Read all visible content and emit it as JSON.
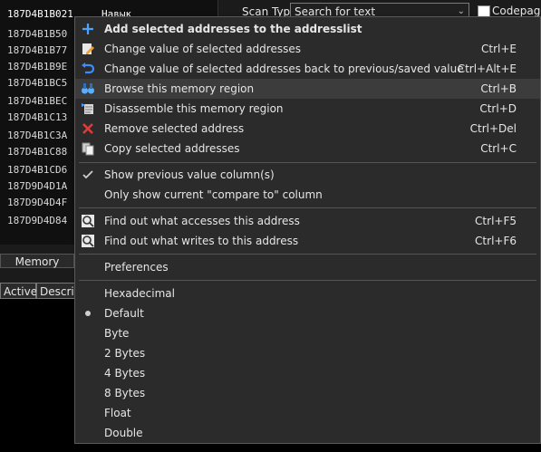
{
  "address_list": {
    "rows": [
      {
        "address": "187D4B1B021",
        "value": "Навык",
        "selected": true
      },
      {
        "address": "187D4B1B50",
        "value": ""
      },
      {
        "address": "187D4B1B77",
        "value": ""
      },
      {
        "address": "187D4B1B9E",
        "value": ""
      },
      {
        "address": "187D4B1BC5",
        "value": ""
      },
      {
        "address": "187D4B1BEC",
        "value": ""
      },
      {
        "address": "187D4B1C13",
        "value": ""
      },
      {
        "address": "187D4B1C3A",
        "value": ""
      },
      {
        "address": "187D4B1C88",
        "value": ""
      },
      {
        "address": "187D4B1CD6",
        "value": ""
      },
      {
        "address": "187D9D4D1A",
        "value": ""
      },
      {
        "address": "187D9D4D4F",
        "value": ""
      },
      {
        "address": "187D9D4D84",
        "value": ""
      }
    ]
  },
  "scan": {
    "type_label": "Scan Type",
    "type_value": "Search for text",
    "codepage_label": "Codepage"
  },
  "memory_view_label": "Memory",
  "table": {
    "columns": [
      "Active",
      "Descrip"
    ]
  },
  "context_menu": {
    "items": [
      {
        "label": "Add selected addresses to the addresslist",
        "shortcut": "",
        "icon": "plus-icon",
        "bold": true
      },
      {
        "label": "Change value of selected addresses",
        "shortcut": "Ctrl+E",
        "icon": "edit-icon"
      },
      {
        "label": "Change value of selected addresses back to previous/saved value",
        "shortcut": "Ctrl+Alt+E",
        "icon": "undo-icon"
      },
      {
        "label": "Browse this memory region",
        "shortcut": "Ctrl+B",
        "icon": "binoculars-icon",
        "hover": true
      },
      {
        "label": "Disassemble this memory region",
        "shortcut": "Ctrl+D",
        "icon": "disassemble-icon"
      },
      {
        "label": "Remove selected address",
        "shortcut": "Ctrl+Del",
        "icon": "remove-icon"
      },
      {
        "label": "Copy selected addresses",
        "shortcut": "Ctrl+C",
        "icon": "copy-icon"
      },
      {
        "label": "Show previous value column(s)",
        "shortcut": "",
        "icon": "check-icon"
      },
      {
        "label": "Only show current \"compare to\" column",
        "shortcut": "",
        "icon": ""
      },
      {
        "label": "Find out what accesses this address",
        "shortcut": "Ctrl+F5",
        "icon": "magnifier-icon"
      },
      {
        "label": "Find out what writes to this address",
        "shortcut": "Ctrl+F6",
        "icon": "magnifier-icon"
      },
      {
        "label": "Preferences",
        "shortcut": "",
        "icon": ""
      },
      {
        "label": "Hexadecimal",
        "shortcut": "",
        "icon": ""
      },
      {
        "label": "Default",
        "shortcut": "",
        "icon": "radio-dot-icon"
      },
      {
        "label": "Byte",
        "shortcut": "",
        "icon": ""
      },
      {
        "label": "2 Bytes",
        "shortcut": "",
        "icon": ""
      },
      {
        "label": "4 Bytes",
        "shortcut": "",
        "icon": ""
      },
      {
        "label": "8 Bytes",
        "shortcut": "",
        "icon": ""
      },
      {
        "label": "Float",
        "shortcut": "",
        "icon": ""
      },
      {
        "label": "Double",
        "shortcut": "",
        "icon": ""
      }
    ]
  }
}
